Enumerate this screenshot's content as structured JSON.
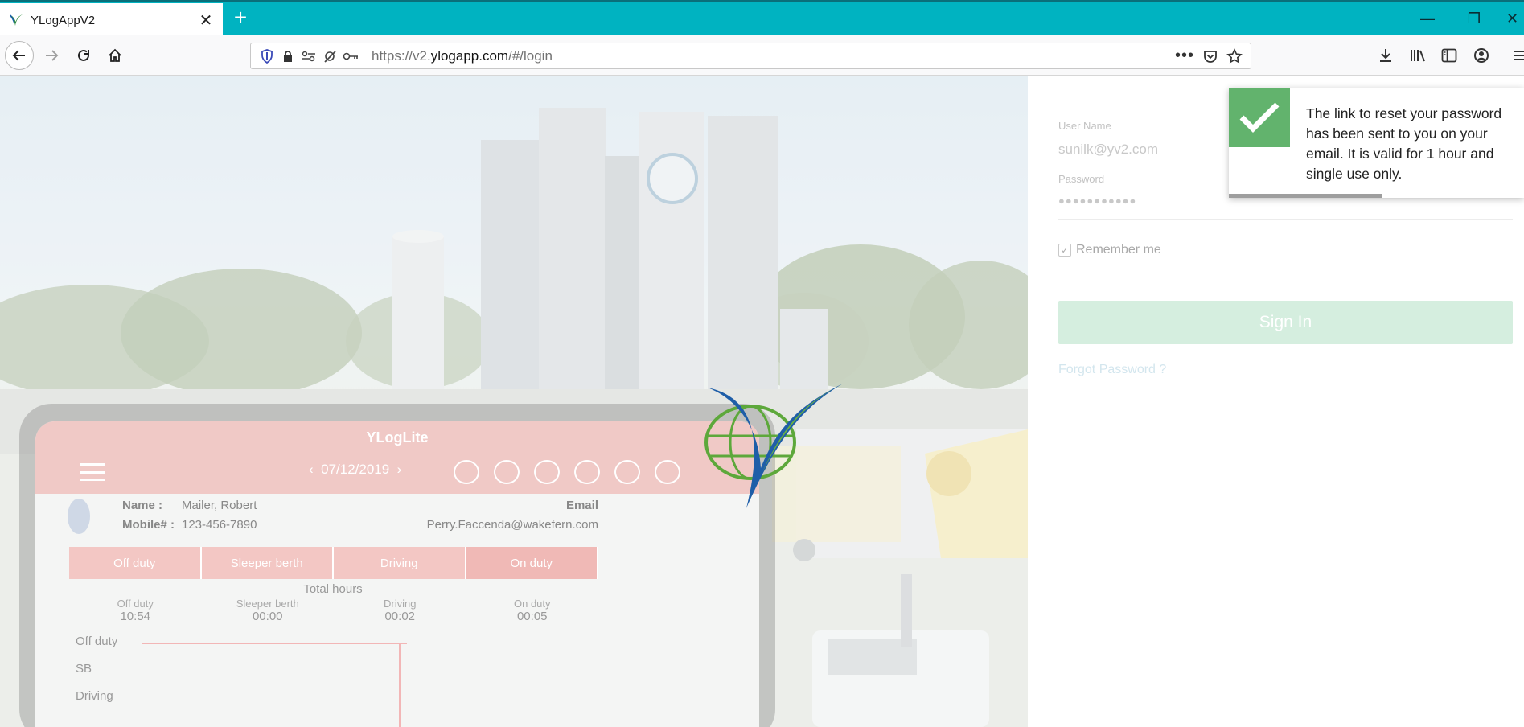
{
  "browser": {
    "tab_title": "YLogAppV2",
    "tab_close": "✕",
    "new_tab": "+",
    "url_prefix": "https://v2.",
    "url_domain": "ylogapp.com",
    "url_path": "/#/login",
    "window_controls": {
      "minimize": "—",
      "restore": "❐",
      "close": "✕"
    }
  },
  "phone_preview": {
    "app_title": "YLogLite",
    "date": "07/12/2019",
    "name_label": "Name :",
    "name_value": "Mailer, Robert",
    "mobile_label": "Mobile# :",
    "mobile_value": "123-456-7890",
    "email_label": "Email",
    "email_value": "Perry.Faccenda@wakefern.com",
    "tabs": [
      "Off duty",
      "Sleeper berth",
      "Driving",
      "On duty"
    ],
    "total_hours_label": "Total hours",
    "hours": [
      {
        "label": "Off duty",
        "value": "10:54"
      },
      {
        "label": "Sleeper berth",
        "value": "00:00"
      },
      {
        "label": "Driving",
        "value": "00:02"
      },
      {
        "label": "On duty",
        "value": "00:05"
      }
    ],
    "graph_labels": [
      "Off duty",
      "SB",
      "Driving"
    ]
  },
  "login": {
    "username_label": "User Name",
    "username_value": "sunilk@yv2.com",
    "password_label": "Password",
    "password_value": "●●●●●●●●●●●",
    "remember_label": "Remember me",
    "remember_checked": true,
    "signin_label": "Sign In",
    "forgot_label": "Forgot Password ?"
  },
  "toast": {
    "message": "The link to reset your password has been sent to you on your email. It is valid for 1 hour and single use only.",
    "status": "success",
    "color": "#62b36d",
    "remaining_fraction": 0.52
  },
  "colors": {
    "tabbar": "#00b3c1",
    "signin_bg": "#d5eedf",
    "phone_header": "#f0c9c6"
  }
}
